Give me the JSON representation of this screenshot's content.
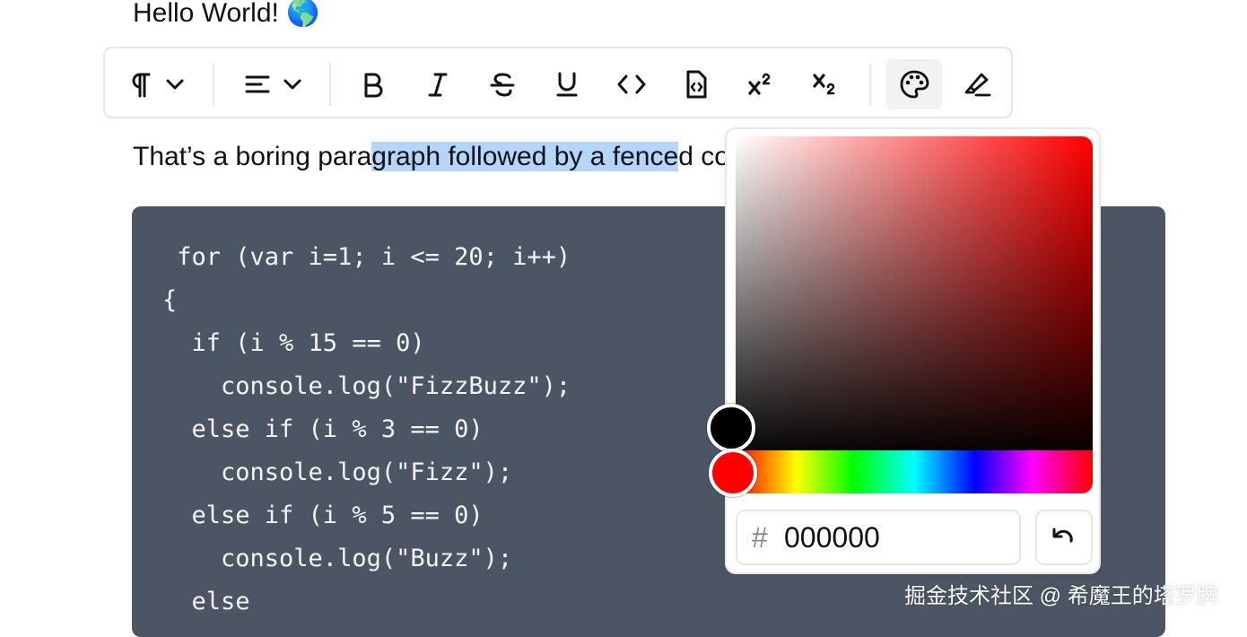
{
  "heading": {
    "text": "Hello World! 🌎"
  },
  "toolbar": {
    "buttons": [
      {
        "name": "paragraph",
        "icon": "pilcrow-icon",
        "dropdown": true
      },
      {
        "name": "align",
        "icon": "align-left-icon",
        "dropdown": true
      },
      {
        "name": "bold",
        "icon": "bold-icon"
      },
      {
        "name": "italic",
        "icon": "italic-icon"
      },
      {
        "name": "strikethrough",
        "icon": "strikethrough-icon"
      },
      {
        "name": "underline",
        "icon": "underline-icon"
      },
      {
        "name": "code",
        "icon": "code-icon"
      },
      {
        "name": "code-block",
        "icon": "code-file-icon"
      },
      {
        "name": "superscript",
        "icon": "superscript-icon"
      },
      {
        "name": "subscript",
        "icon": "subscript-icon"
      },
      {
        "name": "text-color",
        "icon": "palette-icon",
        "active": true
      },
      {
        "name": "highlight",
        "icon": "highlighter-icon"
      }
    ]
  },
  "paragraph": {
    "before": "That’s a boring para",
    "selected": "graph followed by a fence",
    "after": "d code block:"
  },
  "code_block": {
    "lines": [
      " for (var i=1; i <= 20; i++)",
      "{",
      "  if (i % 15 == 0)",
      "    console.log(\"FizzBuzz\");",
      "  else if (i % 3 == 0)",
      "    console.log(\"Fizz\");",
      "  else if (i % 5 == 0)",
      "    console.log(\"Buzz\");",
      "  else"
    ]
  },
  "color_picker": {
    "hash": "#",
    "hex_value": "000000",
    "selected_color": "#000000",
    "hue_color": "#ff0000",
    "reset_icon": "undo-icon"
  },
  "watermark": {
    "text": "掘金技术社区 @ 希魔王的塔罗牌"
  }
}
